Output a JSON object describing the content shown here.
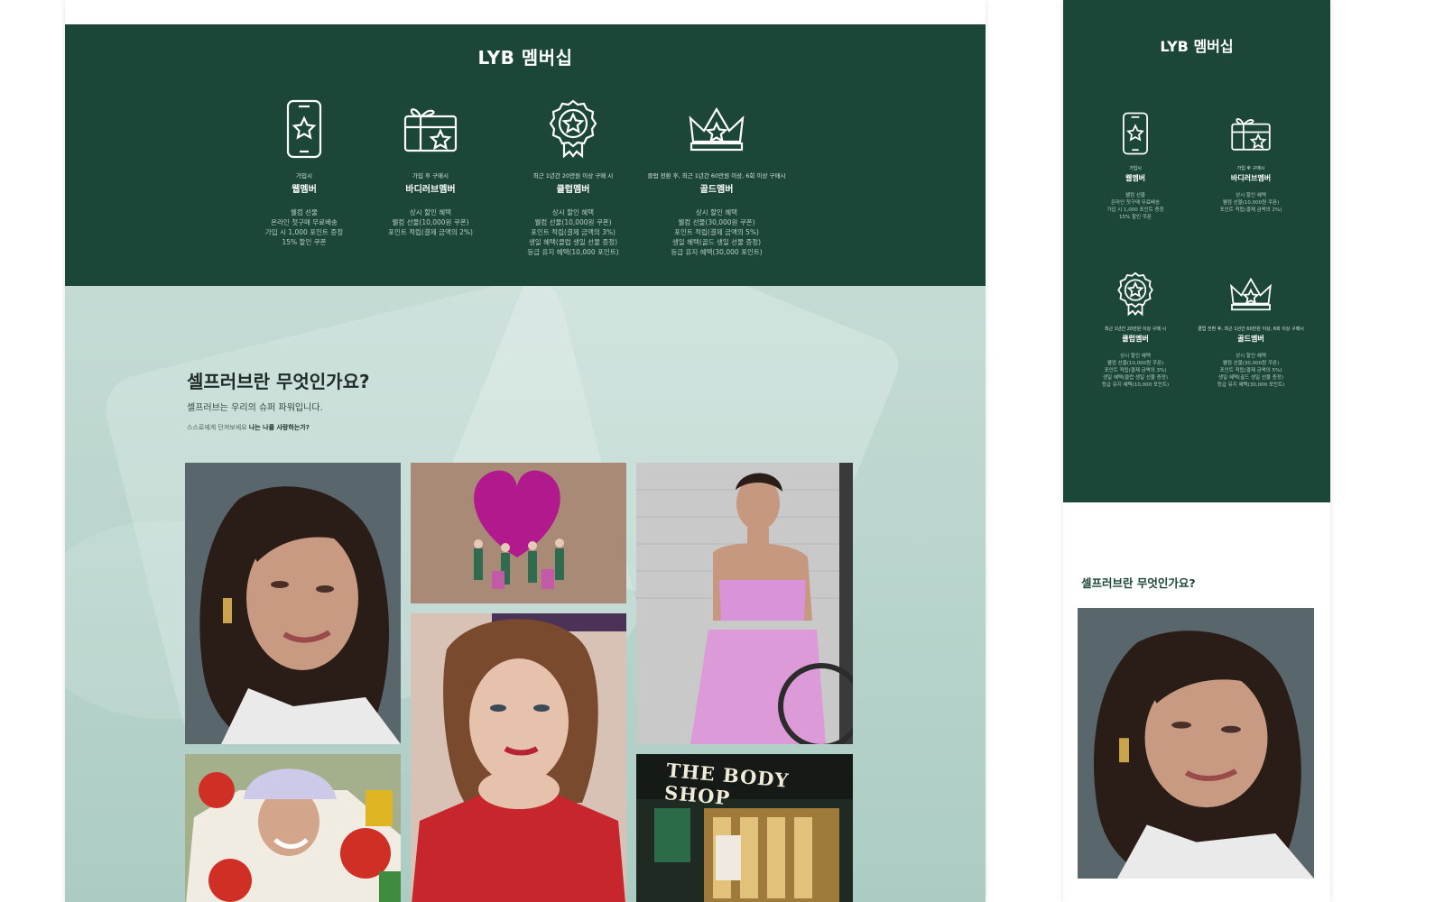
{
  "membership": {
    "title": "LYB 멤버십",
    "tiers": [
      {
        "condition": "가입시",
        "name": "웹멤버",
        "benefits": [
          "웰컴 선물",
          "온라인 첫구매 무료배송",
          "가입 시 1,000 포인트 증정",
          "15% 할인 쿠폰"
        ],
        "icon": "phone-star-icon"
      },
      {
        "condition": "가입 후 구매시",
        "name": "바디러브멤버",
        "benefits": [
          "상시 할인 혜택",
          "웰컴 선물(10,000원 쿠폰)",
          "포인트 적립(결제 금액의 2%)"
        ],
        "icon": "gift-star-icon"
      },
      {
        "condition": "최근 1년간 20만원 이상 구매 시",
        "name": "클럽멤버",
        "benefits": [
          "상시 할인 혜택",
          "웰컴 선물(10,000원 쿠폰)",
          "포인트 적립(결제 금액의 3%)",
          "생일 혜택(클럽 생일 선물 증정)",
          "등급 유지 혜택(10,000 포인트)"
        ],
        "icon": "badge-star-icon"
      },
      {
        "condition": "클럽 전환 후, 최근 1년간 60만원 이상, 6회 이상 구매시",
        "name": "골드멤버",
        "benefits": [
          "상시 할인 혜택",
          "웰컴 선물(30,000원 쿠폰)",
          "포인트 적립(결제 금액의 5%)",
          "생일 혜택(골드 생일 선물 증정)",
          "등급 유지 혜택(30,000 포인트)"
        ],
        "icon": "crown-star-icon"
      }
    ]
  },
  "self_love": {
    "title": "셀프러브란 무엇인가요?",
    "subtitle": "셀프러브는 우리의 슈퍼 파워입니다.",
    "note_prefix": "스스로에게 던져보세요",
    "note_question": "나는 나를 사랑하는가?"
  },
  "photo_store_sign": "THE BODY SHOP",
  "mobile": {
    "membership_title": "LYB 멤버십",
    "self_title": "셀프러브란 무엇인가요?"
  },
  "colors": {
    "brand_green": "#1b4638",
    "mint_bg": "#b9d5cd"
  }
}
